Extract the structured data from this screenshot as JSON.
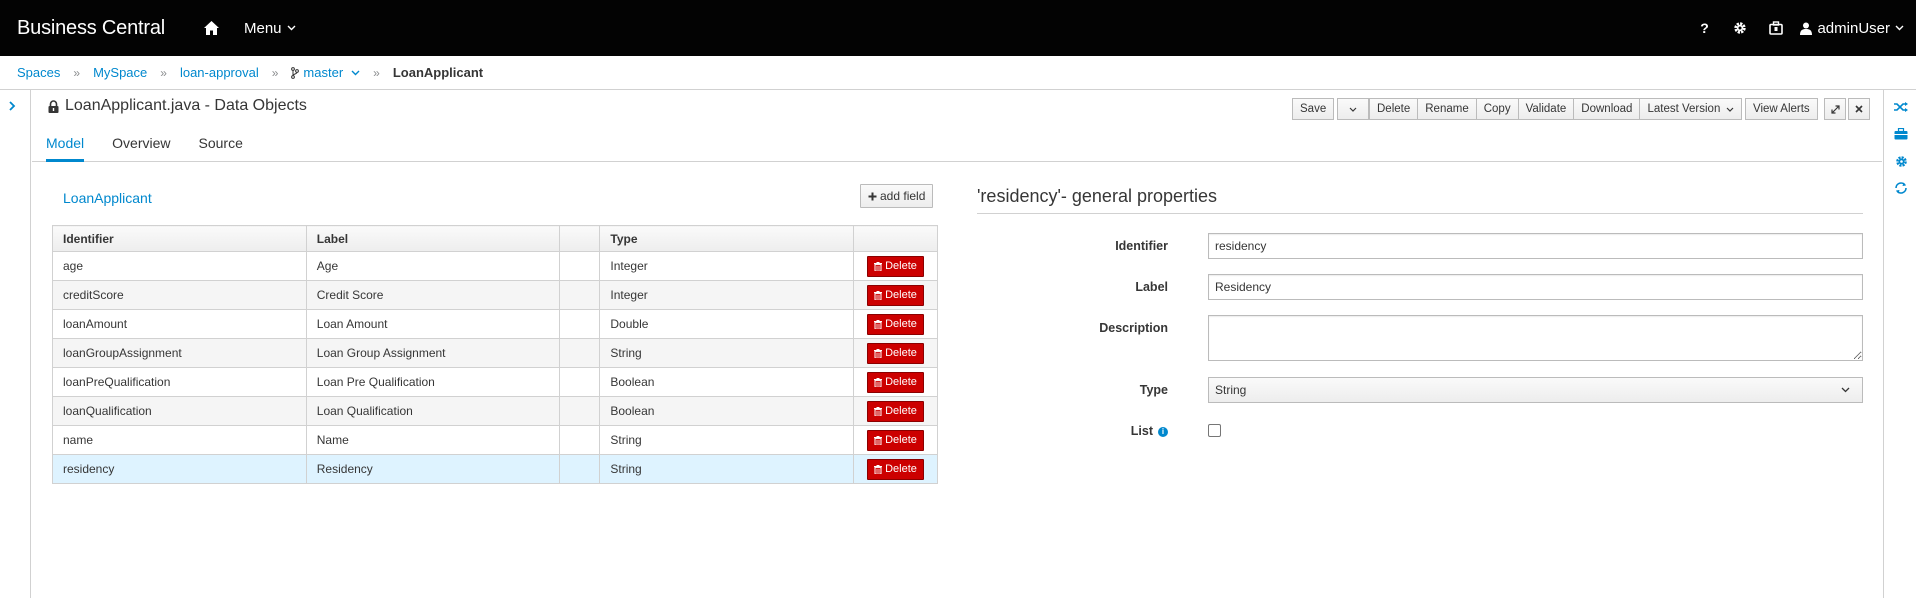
{
  "navbar": {
    "brand": "Business Central",
    "menu_label": "Menu",
    "help_label": "?",
    "user_label": "adminUser"
  },
  "breadcrumb": {
    "items": [
      "Spaces",
      "MySpace",
      "loan-approval"
    ],
    "branch": "master",
    "current": "LoanApplicant"
  },
  "editor": {
    "title": "LoanApplicant.java - Data Objects",
    "toolbar": {
      "save": "Save",
      "delete": "Delete",
      "rename": "Rename",
      "copy": "Copy",
      "validate": "Validate",
      "download": "Download",
      "latest_version": "Latest Version",
      "view_alerts": "View Alerts"
    },
    "tabs": [
      "Model",
      "Overview",
      "Source"
    ],
    "active_tab": "Model"
  },
  "model": {
    "object_name": "LoanApplicant",
    "add_field_label": "add field",
    "columns": [
      "Identifier",
      "Label",
      "",
      "Type",
      ""
    ],
    "delete_label": "Delete",
    "rows": [
      {
        "identifier": "age",
        "label": "Age",
        "type": "Integer"
      },
      {
        "identifier": "creditScore",
        "label": "Credit Score",
        "type": "Integer"
      },
      {
        "identifier": "loanAmount",
        "label": "Loan Amount",
        "type": "Double"
      },
      {
        "identifier": "loanGroupAssignment",
        "label": "Loan Group Assignment",
        "type": "String"
      },
      {
        "identifier": "loanPreQualification",
        "label": "Loan Pre Qualification",
        "type": "Boolean"
      },
      {
        "identifier": "loanQualification",
        "label": "Loan Qualification",
        "type": "Boolean"
      },
      {
        "identifier": "name",
        "label": "Name",
        "type": "String"
      },
      {
        "identifier": "residency",
        "label": "Residency",
        "type": "String"
      }
    ],
    "selected_row": "residency"
  },
  "properties": {
    "title": "'residency'- general properties",
    "identifier_label": "Identifier",
    "identifier_value": "residency",
    "label_label": "Label",
    "label_value": "Residency",
    "description_label": "Description",
    "description_value": "",
    "type_label": "Type",
    "type_value": "String",
    "list_label": "List",
    "list_checked": false
  },
  "colors": {
    "navbar_bg": "#030303",
    "link": "#0088ce",
    "delete_button": "#cc0000",
    "selected_row": "#def3ff"
  }
}
